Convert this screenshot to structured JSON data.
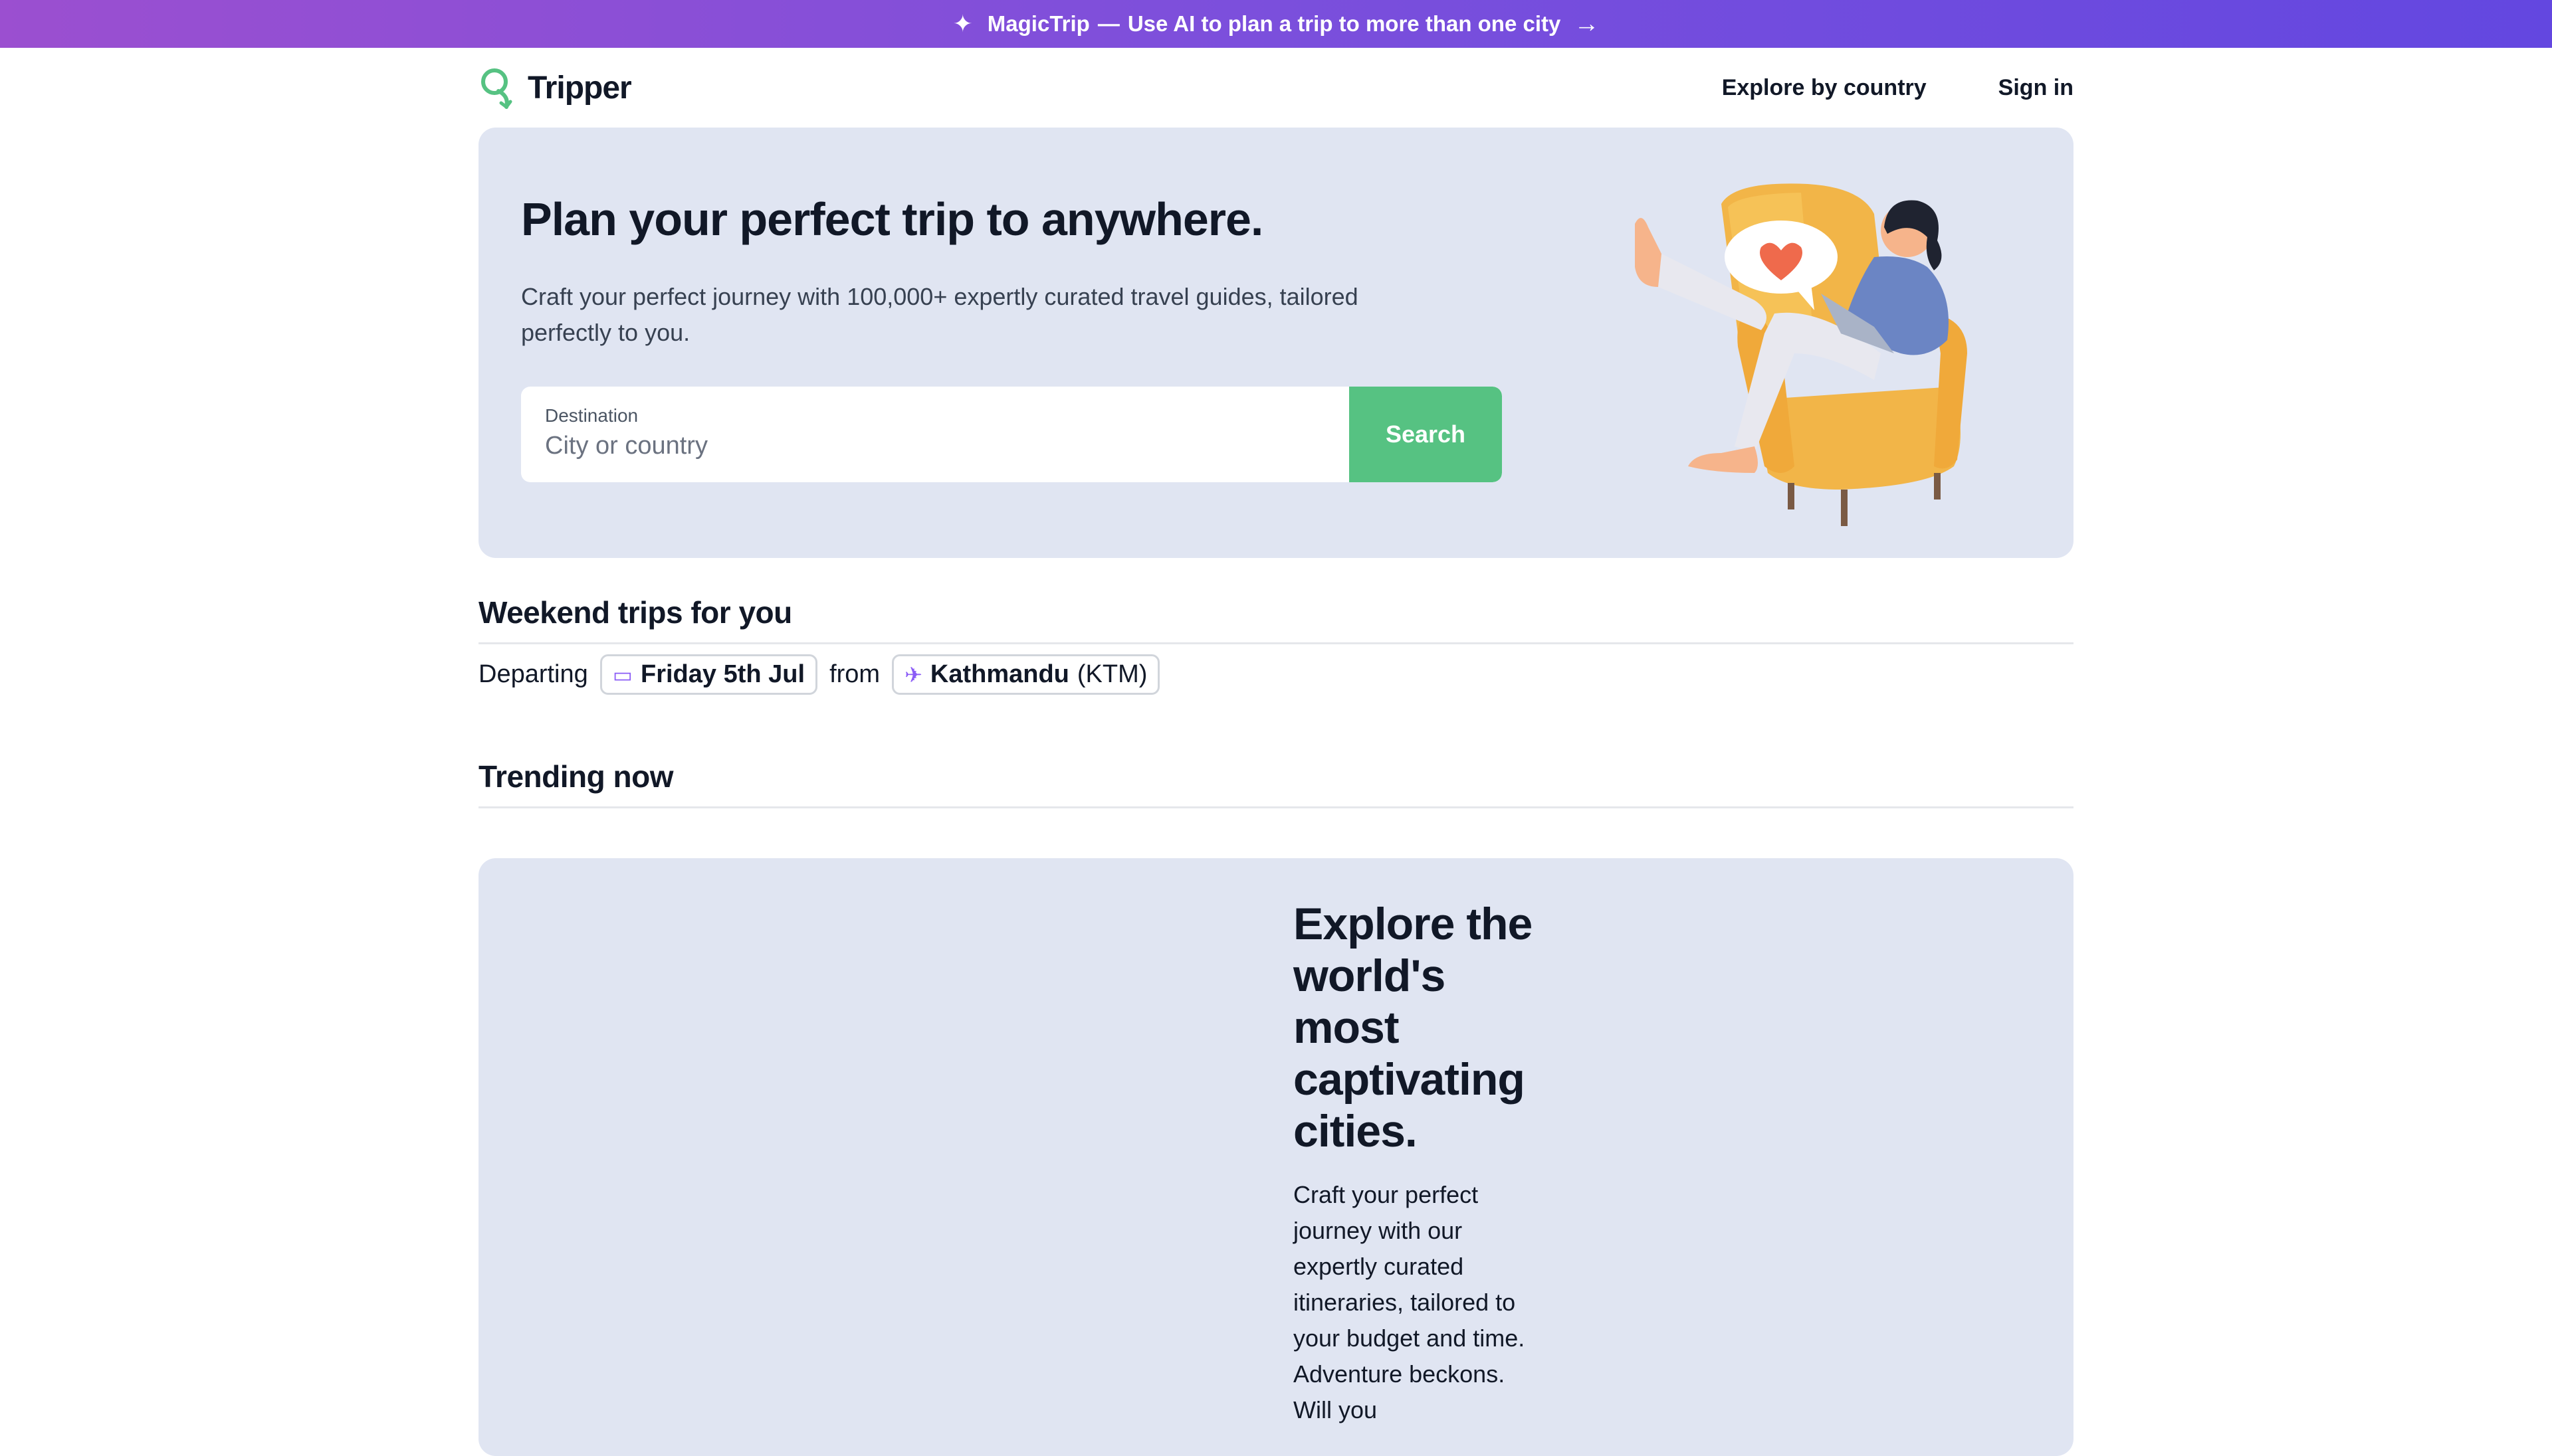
{
  "promo": {
    "brand": "MagicTrip",
    "separator": "—",
    "text": "Use AI to plan a trip to more than one city",
    "sparkle_icon": "sparkle-icon",
    "arrow_icon": "arrow-right-icon"
  },
  "header": {
    "logo_text": "Tripper",
    "nav": {
      "explore_label": "Explore by country",
      "signin_label": "Sign in"
    }
  },
  "hero": {
    "title": "Plan your perfect trip to anywhere.",
    "subtitle": "Craft your perfect journey with 100,000+ expertly curated travel guides, tailored perfectly to you.",
    "search": {
      "label": "Destination",
      "placeholder": "City or country",
      "value": "",
      "button_label": "Search"
    }
  },
  "weekend": {
    "title": "Weekend trips for you",
    "departing_label": "Departing",
    "date": "Friday 5th Jul",
    "from_label": "from",
    "origin_city": "Kathmandu",
    "origin_code": "(KTM)"
  },
  "trending": {
    "title": "Trending now"
  },
  "explore": {
    "title": "Explore the world's most captivating cities.",
    "body": "Craft your perfect journey with our expertly curated itineraries, tailored to your budget and time. Adventure beckons. Will you"
  },
  "colors": {
    "banner_start": "#9b4fd0",
    "banner_end": "#6347e0",
    "accent_green": "#56c282",
    "hero_bg": "#e0e5f2",
    "chip_icon": "#8b5cf6"
  }
}
